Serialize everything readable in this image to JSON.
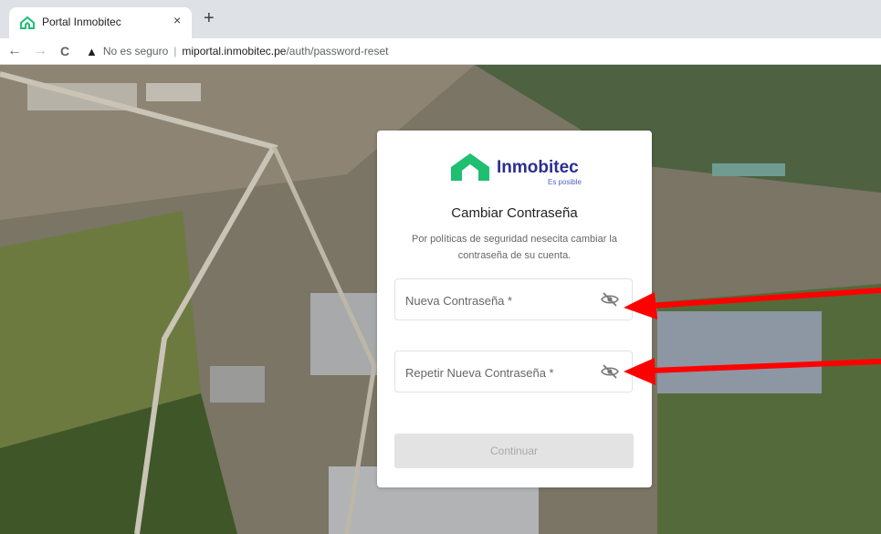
{
  "browser": {
    "tab_title": "Portal Inmobitec",
    "close_symbol": "×",
    "new_tab_symbol": "+",
    "back_symbol": "←",
    "forward_symbol": "→",
    "reload_symbol": "C",
    "security_warning": "No es seguro",
    "url_host": "miportal.inmobitec.pe",
    "url_path": "/auth/password-reset"
  },
  "card": {
    "logo_word": "Inmobitec",
    "logo_tagline": "Es posible",
    "title": "Cambiar Contraseña",
    "description": "Por políticas de seguridad nesecita cambiar la contraseña de su cuenta.",
    "new_password_placeholder": "Nueva Contraseña *",
    "repeat_password_placeholder": "Repetir Nueva Contraseña *",
    "continue_label": "Continuar"
  },
  "colors": {
    "brand_green": "#1fbf72",
    "brand_blue": "#2b2f8f",
    "annotation_red": "#ff0000"
  },
  "icons": [
    "inmobitec-logo-icon",
    "eye-off-icon",
    "eye-off-icon"
  ]
}
